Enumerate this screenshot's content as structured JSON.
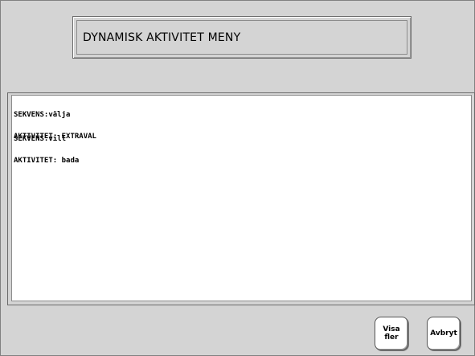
{
  "header": {
    "title": "DYNAMISK AKTIVITET MENY"
  },
  "entries": [
    {
      "sequence_line": "SEKVENS:välja",
      "activity_line": "AKTIVITET: EXTRAVAL"
    },
    {
      "sequence_line": "SEKVENS:vill",
      "activity_line": "AKTIVITET: bada"
    }
  ],
  "buttons": {
    "more_label": "Visa\nfler",
    "cancel_label": "Avbryt"
  },
  "colors": {
    "background": "#d4d4d4",
    "content_background": "#ffffff",
    "button_background": "#ffffff"
  }
}
